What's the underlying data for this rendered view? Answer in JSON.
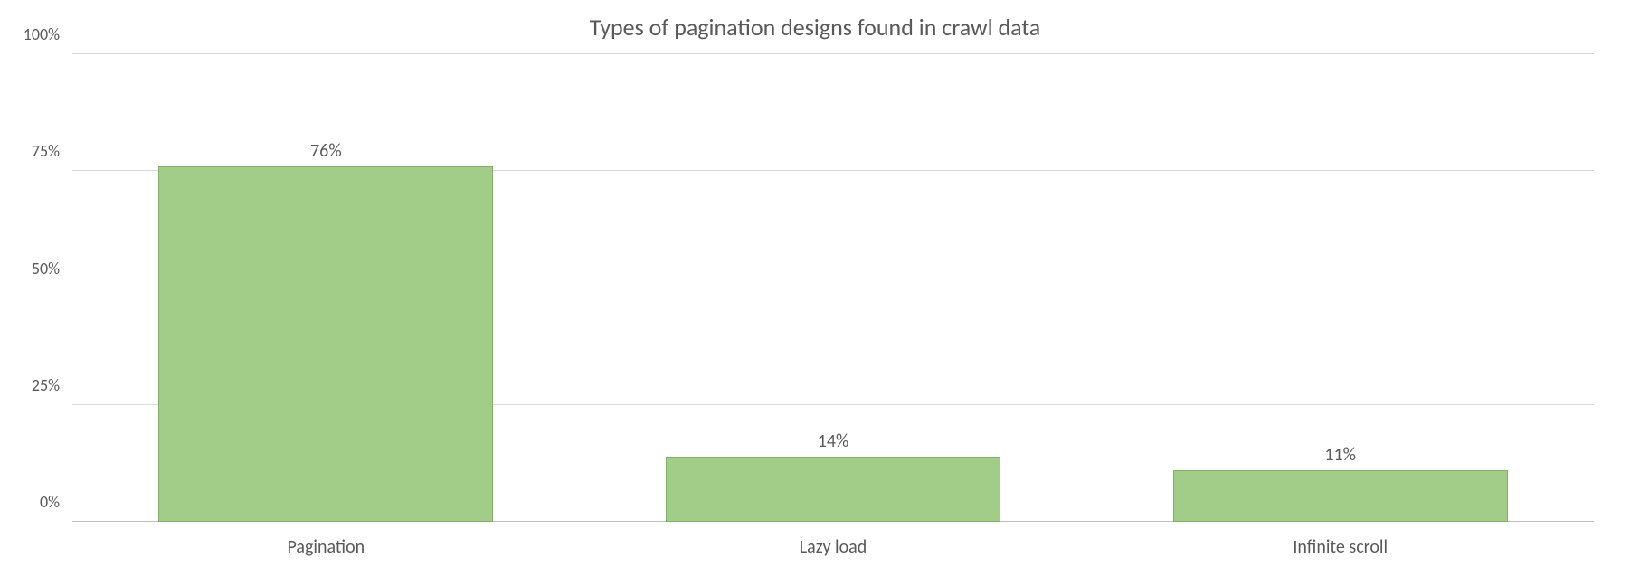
{
  "chart_data": {
    "type": "bar",
    "title": "Types of pagination designs found in crawl data",
    "categories": [
      "Pagination",
      "Lazy load",
      "Infinite scroll"
    ],
    "values": [
      76,
      14,
      11
    ],
    "value_suffix": "%",
    "ylabel": "",
    "xlabel": "",
    "ylim": [
      0,
      100
    ],
    "yticks": [
      0,
      25,
      50,
      75,
      100
    ],
    "ytick_labels": [
      "0%",
      "25%",
      "50%",
      "75%",
      "100%"
    ],
    "bar_color": "#a1cd89",
    "bar_border": "#83b069"
  }
}
